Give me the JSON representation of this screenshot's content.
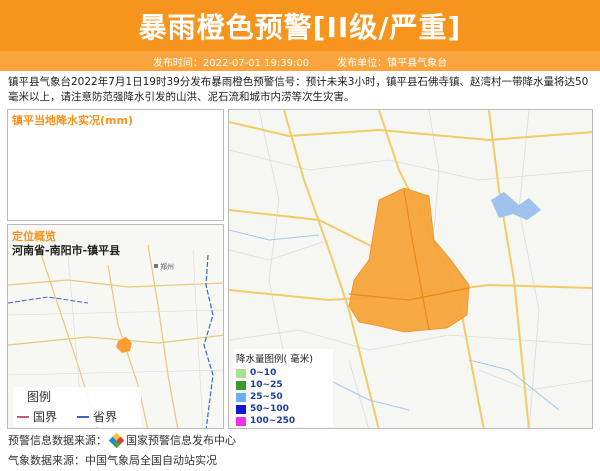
{
  "header": {
    "title": "暴雨橙色预警[II级/严重]"
  },
  "meta": {
    "time_label": "发布时间：",
    "time_value": "2022-07-01 19:39:00",
    "unit_label": "发布单位：",
    "unit_value": "镇平县气象台"
  },
  "description": "镇平县气象台2022年7月1日19时39分发布暴雨橙色预警信号：预计未来3小时，镇平县石佛寺镇、赵湾村一带降水量将达50毫米以上，请注意防范强降水引发的山洪、泥石流和城市内涝等次生灾害。",
  "rain_panel": {
    "title": "镇平当地降水实况(mm)"
  },
  "location_panel": {
    "title": "定位概览",
    "region": "河南省-南阳市-镇平县",
    "city_label": "郑州",
    "legend_title": "图例",
    "legend_items": [
      {
        "label": "国界",
        "color": "#c0607a"
      },
      {
        "label": "省界",
        "color": "#3a66c4"
      }
    ]
  },
  "map_legend": {
    "title": "降水量图例( 毫米)",
    "items": [
      {
        "label": "0~10",
        "color": "#a6e28f"
      },
      {
        "label": "10~25",
        "color": "#3a9a2a"
      },
      {
        "label": "25~50",
        "color": "#68b0f5"
      },
      {
        "label": "50~100",
        "color": "#1414d6"
      },
      {
        "label": "100~250",
        "color": "#f032f0"
      }
    ]
  },
  "footer": {
    "source1_label": "预警信息数据来源：",
    "source1_value": "国家预警信息发布中心",
    "source2_label": "气象数据来源：",
    "source2_value": "中国气象局全国自动站实况"
  },
  "colors": {
    "accent": "#f7941d",
    "warning_area": "#f7a53a"
  }
}
